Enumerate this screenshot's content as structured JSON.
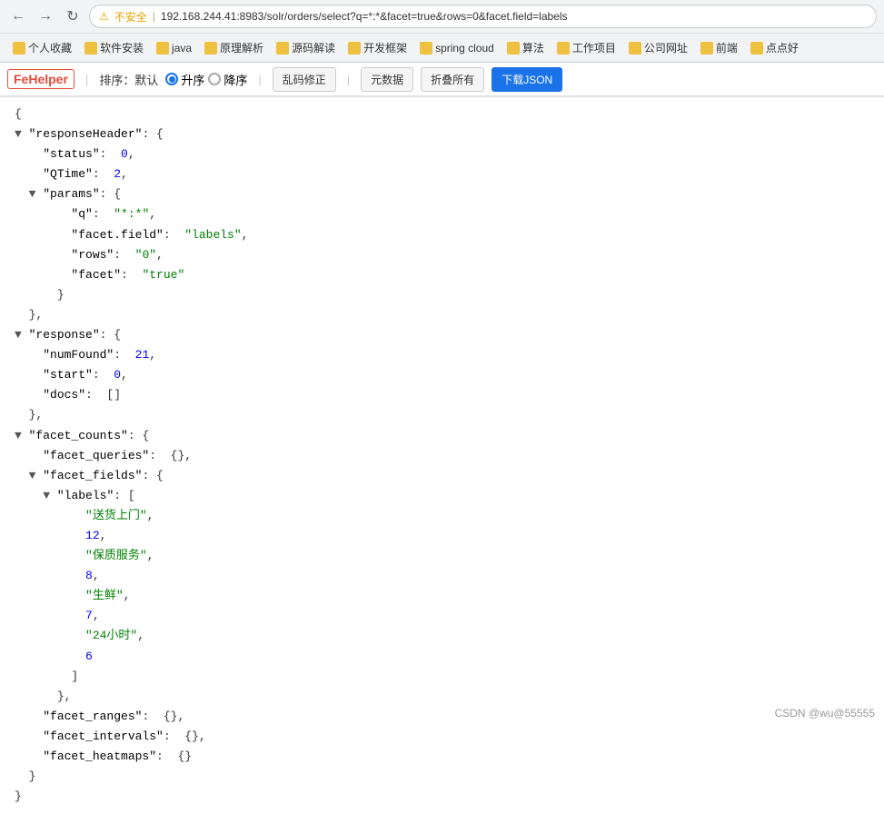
{
  "browser": {
    "address": "192.168.244.41:8983/solr/orders/select?q=*:*&facet=true&rows=0&facet.field=labels",
    "security_label": "不安全",
    "back_title": "后退",
    "forward_title": "前进",
    "refresh_title": "刷新"
  },
  "bookmarks": [
    {
      "label": "个人收藏",
      "type": "star"
    },
    {
      "label": "软件安装",
      "type": "folder"
    },
    {
      "label": "java",
      "type": "folder"
    },
    {
      "label": "原理解析",
      "type": "folder"
    },
    {
      "label": "源码解读",
      "type": "folder"
    },
    {
      "label": "开发框架",
      "type": "folder"
    },
    {
      "label": "spring cloud",
      "type": "folder"
    },
    {
      "label": "算法",
      "type": "folder"
    },
    {
      "label": "工作项目",
      "type": "folder"
    },
    {
      "label": "公司网址",
      "type": "folder"
    },
    {
      "label": "前端",
      "type": "folder"
    },
    {
      "label": "点点好",
      "type": "folder"
    }
  ],
  "fehelper": {
    "logo": "FeHelper",
    "sort_label": "排序：默认",
    "asc_label": "升序",
    "desc_label": "降序",
    "btn_encode": "乱码修正",
    "btn_meta": "元数据",
    "btn_collapse": "折叠所有",
    "btn_download": "下载JSON"
  },
  "json_display": {
    "lines": [
      {
        "indent": 0,
        "content": "{"
      },
      {
        "indent": 0,
        "arrow": "▼",
        "content": "  \"responseHeader\": {"
      },
      {
        "indent": 1,
        "content": "    \"status\":  0,",
        "key": "status",
        "value": "0",
        "value_type": "number"
      },
      {
        "indent": 1,
        "content": "    \"QTime\":  2,",
        "key": "QTime",
        "value": "2",
        "value_type": "number"
      },
      {
        "indent": 1,
        "arrow": "▼",
        "content": "    \"params\": {"
      },
      {
        "indent": 2,
        "content": "      \"q\":  \"*:*\",",
        "key": "q",
        "value": "*:*",
        "value_type": "string"
      },
      {
        "indent": 2,
        "content": "      \"facet.field\":  \"labels\",",
        "key": "facet.field",
        "value": "labels",
        "value_type": "string"
      },
      {
        "indent": 2,
        "content": "      \"rows\":  \"0\",",
        "key": "rows",
        "value": "0",
        "value_type": "string"
      },
      {
        "indent": 2,
        "content": "      \"facet\":  \"true\"",
        "key": "facet",
        "value": "true",
        "value_type": "string"
      },
      {
        "indent": 1,
        "content": "    }"
      },
      {
        "indent": 0,
        "content": "  },"
      },
      {
        "indent": 0,
        "arrow": "▼",
        "content": "  \"response\": {"
      },
      {
        "indent": 1,
        "content": "    \"numFound\":  21,",
        "key": "numFound",
        "value": "21",
        "value_type": "number"
      },
      {
        "indent": 1,
        "content": "    \"start\":  0,",
        "key": "start",
        "value": "0",
        "value_type": "number"
      },
      {
        "indent": 1,
        "content": "    \"docs\":  []"
      },
      {
        "indent": 0,
        "content": "  },"
      },
      {
        "indent": 0,
        "arrow": "▼",
        "content": "  \"facet_counts\": {"
      },
      {
        "indent": 1,
        "content": "    \"facet_queries\":  {},"
      },
      {
        "indent": 1,
        "arrow": "▼",
        "content": "    \"facet_fields\": {"
      },
      {
        "indent": 2,
        "arrow": "▼",
        "content": "      \"labels\": ["
      },
      {
        "indent": 3,
        "content": "        \"送货上门\",",
        "value_type": "string",
        "value": "送货上门"
      },
      {
        "indent": 3,
        "content": "        12,",
        "value_type": "number"
      },
      {
        "indent": 3,
        "content": "        \"保质服务\",",
        "value_type": "string",
        "value": "保质服务"
      },
      {
        "indent": 3,
        "content": "        8,",
        "value_type": "number"
      },
      {
        "indent": 3,
        "content": "        \"生鲜\",",
        "value_type": "string",
        "value": "生鲜"
      },
      {
        "indent": 3,
        "content": "        7,",
        "value_type": "number"
      },
      {
        "indent": 3,
        "content": "        \"24小时\",",
        "value_type": "string",
        "value": "24小时"
      },
      {
        "indent": 3,
        "content": "        6",
        "value_type": "number"
      },
      {
        "indent": 2,
        "content": "      ]"
      },
      {
        "indent": 1,
        "content": "    },"
      },
      {
        "indent": 1,
        "content": "    \"facet_ranges\":  {},"
      },
      {
        "indent": 1,
        "content": "    \"facet_intervals\":  {},"
      },
      {
        "indent": 1,
        "content": "    \"facet_heatmaps\":  {}"
      },
      {
        "indent": 0,
        "content": "  }"
      },
      {
        "indent": 0,
        "content": "}"
      }
    ]
  },
  "watermark": "CSDN @wu@55555"
}
